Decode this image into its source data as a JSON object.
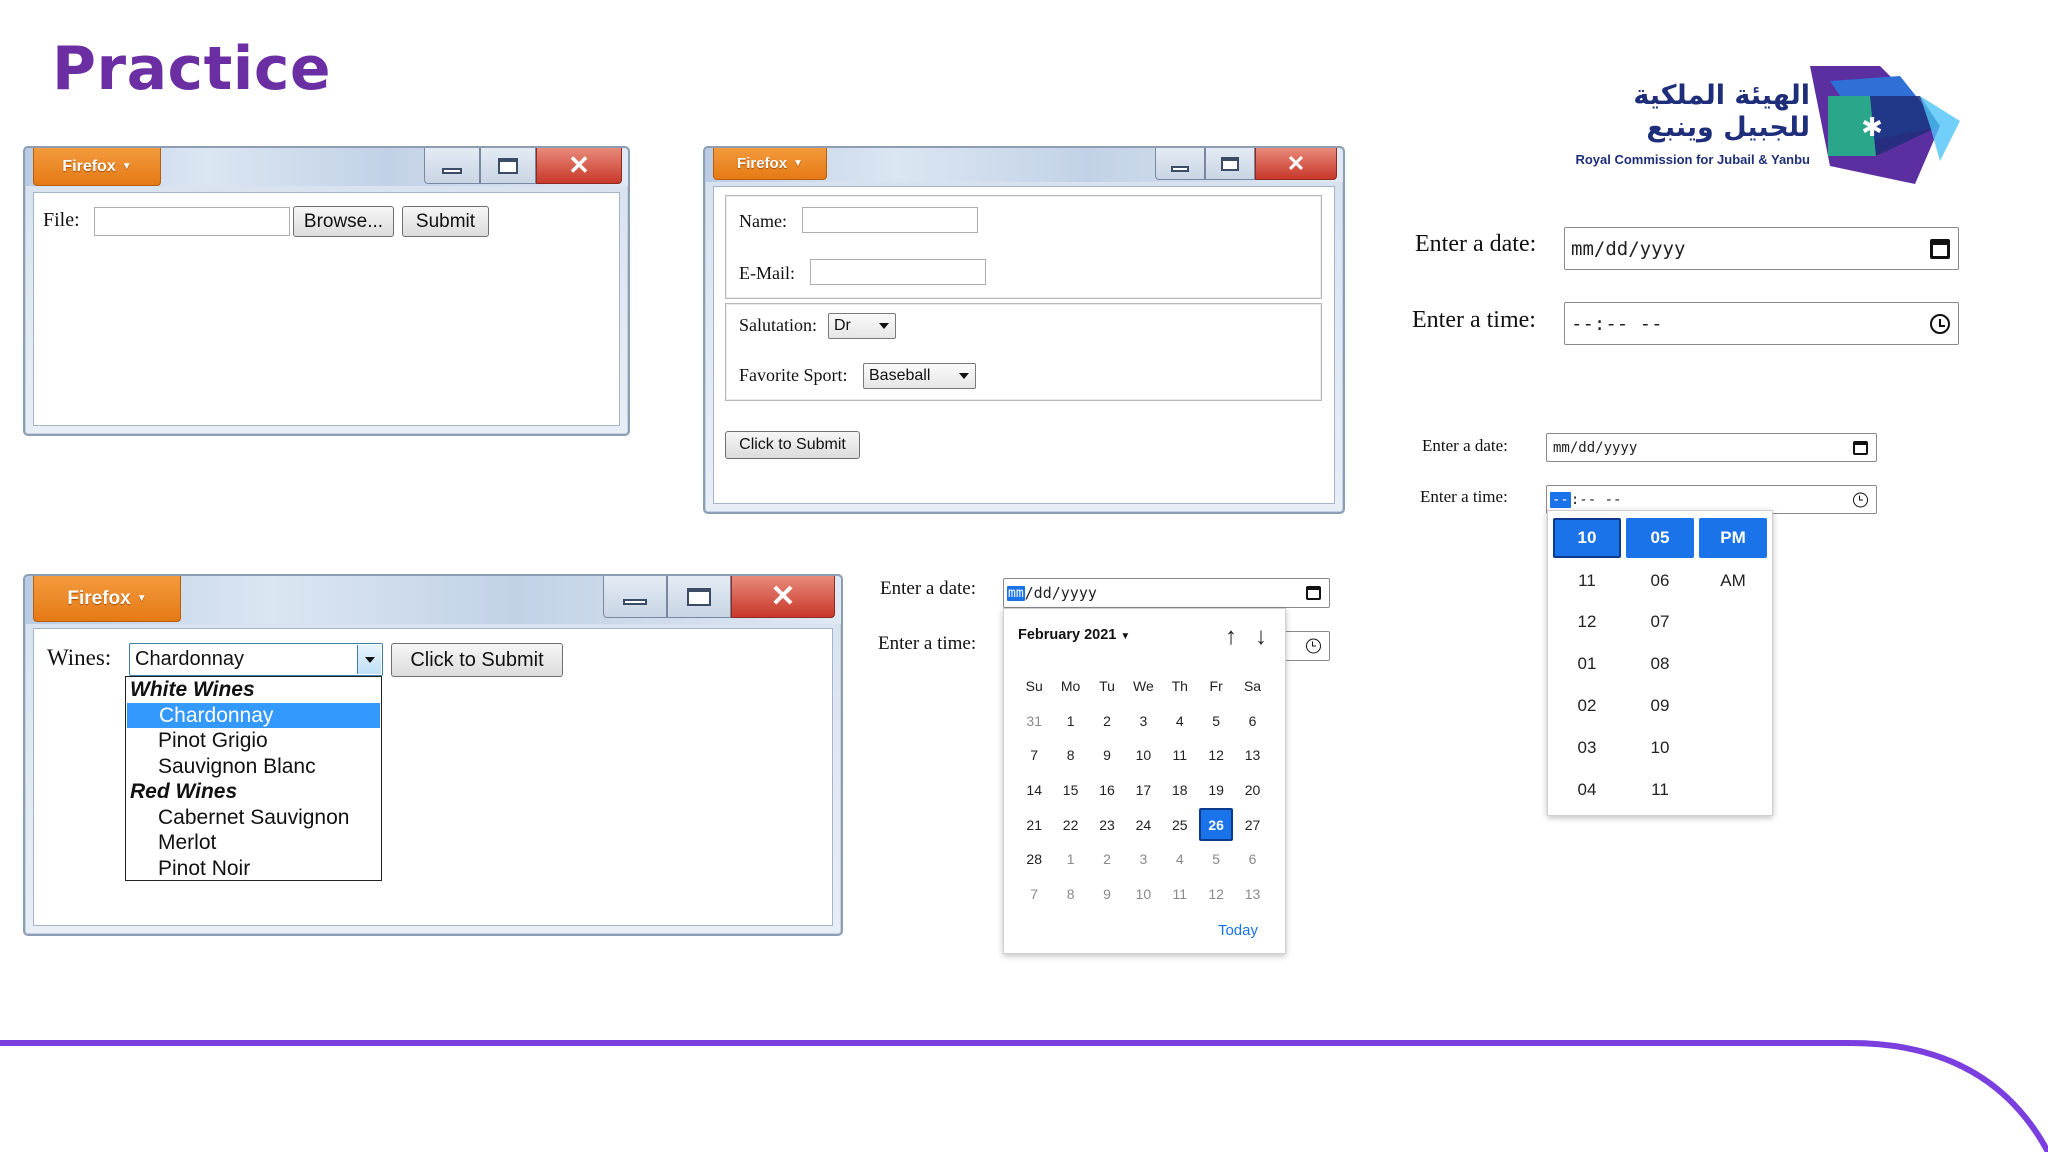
{
  "slide": {
    "title": "Practice"
  },
  "logo": {
    "arabic_line1": "الهيئة الملكية",
    "arabic_line2": "للجبيل وينبع",
    "english": "Royal Commission for Jubail & Yanbu",
    "colors": {
      "navy": "#1f2e7a",
      "blue": "#2f6fd6",
      "teal": "#2aa68a",
      "purple": "#5b2fa0"
    }
  },
  "window1": {
    "menu_label": "Firefox",
    "file_label": "File:",
    "browse_label": "Browse...",
    "submit_label": "Submit"
  },
  "window2": {
    "menu_label": "Firefox",
    "name_label": "Name:",
    "email_label": "E-Mail:",
    "salutation_label": "Salutation:",
    "salutation_value": "Dr",
    "sport_label": "Favorite Sport:",
    "sport_value": "Baseball",
    "submit_label": "Click to Submit"
  },
  "window3": {
    "menu_label": "Firefox",
    "wines_label": "Wines:",
    "wines_value": "Chardonnay",
    "submit_label": "Click to Submit",
    "groups": [
      {
        "label": "White Wines",
        "items": [
          "Chardonnay",
          "Pinot Grigio",
          "Sauvignon Blanc"
        ]
      },
      {
        "label": "Red Wines",
        "items": [
          "Cabernet Sauvignon",
          "Merlot",
          "Pinot Noir"
        ]
      }
    ],
    "selected": "Chardonnay"
  },
  "inputs_right_top": {
    "date_label": "Enter a date:",
    "date_placeholder": "mm/dd/yyyy",
    "time_label": "Enter a time:",
    "time_placeholder": "--:-- --"
  },
  "inputs_middle": {
    "date_label": "Enter a date:",
    "date_rest": "/dd/yyyy",
    "date_highlight": "mm",
    "time_label": "Enter a time:"
  },
  "calendar": {
    "month_label": "February 2021",
    "weekdays": [
      "Su",
      "Mo",
      "Tu",
      "We",
      "Th",
      "Fr",
      "Sa"
    ],
    "days": [
      "31",
      "1",
      "2",
      "3",
      "4",
      "5",
      "6",
      "7",
      "8",
      "9",
      "10",
      "11",
      "12",
      "13",
      "14",
      "15",
      "16",
      "17",
      "18",
      "19",
      "20",
      "21",
      "22",
      "23",
      "24",
      "25",
      "26",
      "27",
      "28",
      "1",
      "2",
      "3",
      "4",
      "5",
      "6",
      "7",
      "8",
      "9",
      "10",
      "11",
      "12",
      "13"
    ],
    "selected_day": "26",
    "today_label": "Today"
  },
  "inputs_right_small": {
    "date_label": "Enter a date:",
    "date_placeholder": "mm/dd/yyyy",
    "time_label": "Enter a time:",
    "time_highlight": "--",
    "time_rest": ":-- --"
  },
  "time_picker": {
    "hours": [
      "10",
      "11",
      "12",
      "01",
      "02",
      "03",
      "04"
    ],
    "minutes": [
      "05",
      "06",
      "07",
      "08",
      "09",
      "10",
      "11"
    ],
    "periods": [
      "PM",
      "AM"
    ]
  },
  "theme": {
    "purple": "#6b2fa3",
    "accent_blue": "#1a73e8",
    "firefox_orange": "#e57a15"
  }
}
